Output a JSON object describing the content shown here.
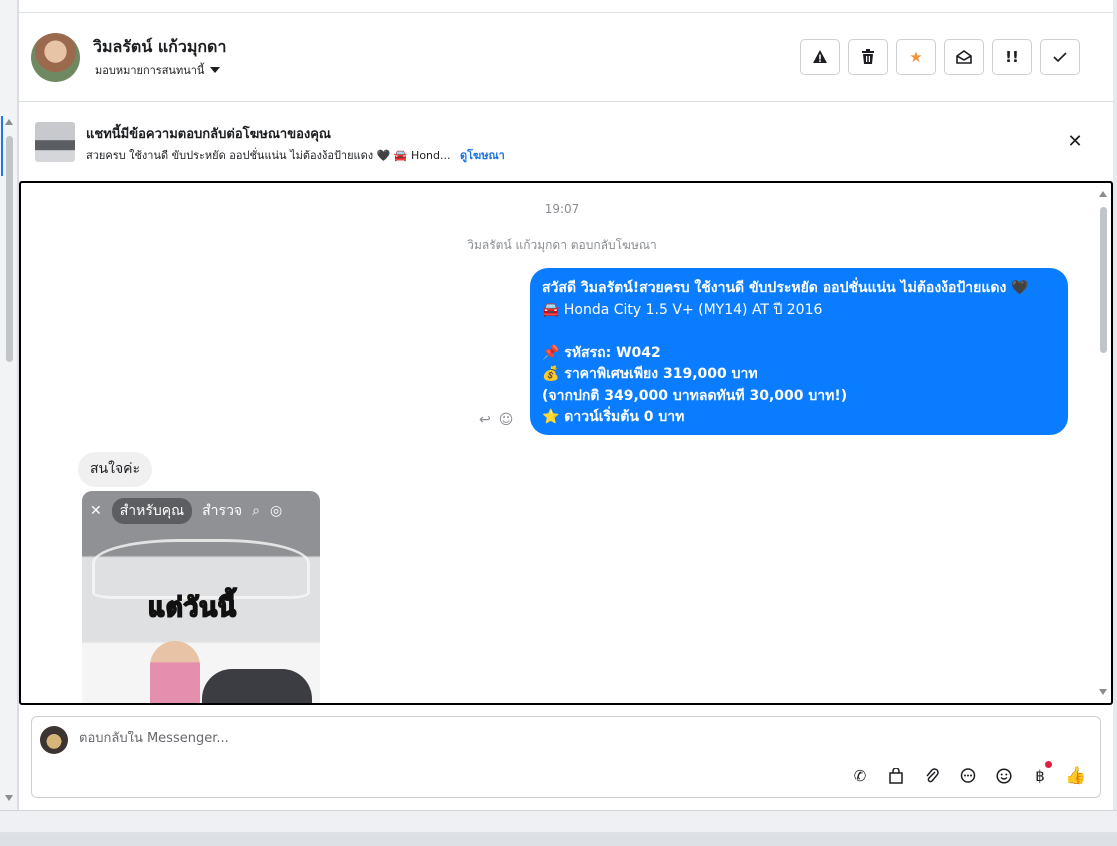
{
  "header": {
    "contact_name": "วิมลรัตน์ แก้วมุกดา",
    "assign_label": "มอบหมายการสนทนานี้",
    "actions": [
      {
        "name": "report-button",
        "icon": "warning-icon"
      },
      {
        "name": "delete-button",
        "icon": "trash-icon"
      },
      {
        "name": "star-button",
        "icon": "star-icon"
      },
      {
        "name": "mark-unread-button",
        "icon": "envelope-open-icon"
      },
      {
        "name": "follow-up-button",
        "icon": "double-exclamation-icon"
      },
      {
        "name": "mark-done-button",
        "icon": "check-icon"
      }
    ]
  },
  "ad_banner": {
    "title": "แชทนี้มีข้อความตอบกลับต่อโฆษณาของคุณ",
    "subtitle": "สวยครบ ใช้งานดี ขับประหยัด ออปชั่นแน่น ไม่ต้องง้อป้ายแดง 🖤 🚘 Hond...",
    "link": "ดูโฆษณา"
  },
  "chat": {
    "timestamp": "19:07",
    "system_note": "วิมลรัตน์ แก้วมุกดา ตอบกลับโฆษณา",
    "outgoing_message": {
      "lines": [
        "สวัสดี วิมลรัตน์!สวยครบ ใช้งานดี ขับประหยัด ออปชั่นแน่น ไม่ต้องง้อป้ายแดง 🖤",
        "🚘 Honda City 1.5 V+ (MY14) AT ปี 2016",
        "",
        "📌 รหัสรถ: W042",
        "💰 ราคาพิเศษเพียง 319,000 บาท",
        "(จากปกติ 349,000 บาทลดทันที 30,000 บาท!)",
        "⭐ ดาวน์เริ่มต้น 0 บาท"
      ]
    },
    "incoming_message": "สนใจค่ะ",
    "story": {
      "tab_for_you": "สำหรับคุณ",
      "tab_explore": "สำรวจ",
      "headline": "แต่วันนี้"
    }
  },
  "composer": {
    "placeholder": "ตอบกลับใน Messenger..."
  }
}
